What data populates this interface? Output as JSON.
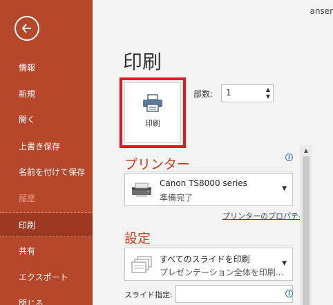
{
  "sidebar": {
    "back_icon": "arrow-left-circle-icon",
    "items": [
      {
        "label": "情報",
        "state": "normal"
      },
      {
        "label": "新規",
        "state": "normal"
      },
      {
        "label": "開く",
        "state": "normal"
      },
      {
        "label": "上書き保存",
        "state": "normal"
      },
      {
        "label": "名前を付けて保存",
        "state": "normal"
      },
      {
        "label": "履歴",
        "state": "disabled"
      },
      {
        "label": "印刷",
        "state": "selected"
      },
      {
        "label": "共有",
        "state": "normal"
      },
      {
        "label": "エクスポート",
        "state": "normal"
      },
      {
        "label": "閉じる",
        "state": "normal"
      }
    ]
  },
  "header": {
    "user_name": "anser"
  },
  "main": {
    "title": "印刷",
    "print_button_label": "印刷",
    "copies_label": "部数:",
    "copies_value": "1",
    "printer_section": {
      "title": "プリンター",
      "printer_name": "Canon TS8000 series",
      "printer_status": "準備完了",
      "properties_link": "プリンターのプロパティ"
    },
    "settings_section": {
      "title": "設定",
      "slides_option": "すべてのスライドを印刷",
      "slides_option_desc": "プレゼンテーション全体を印刷…",
      "slide_spec_label": "スライド指定:",
      "slide_spec_value": ""
    }
  },
  "colors": {
    "sidebar_bg": "#b7472a",
    "accent": "#c43e1c",
    "highlight_frame": "#e8141e",
    "link": "#1f4e79"
  }
}
